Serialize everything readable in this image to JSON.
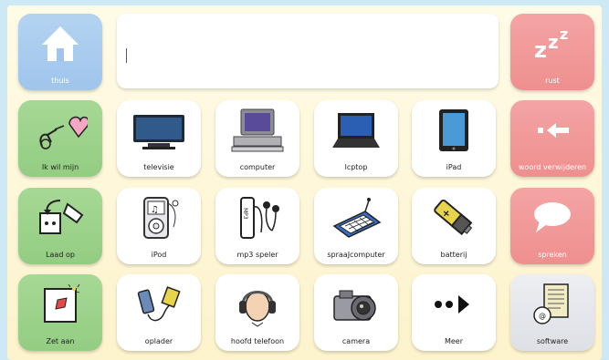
{
  "message_bar": {
    "text": ""
  },
  "tiles": {
    "thuis": "thuis",
    "rust": "rust",
    "rust_icon": "zzz",
    "ik_wil_mijn": "Ik wil mijn",
    "televisie": "televisie",
    "computer": "computer",
    "laptop": "lcptop",
    "ipad": "iPad",
    "woord_verwijderen": "woord verwijderen",
    "laad_op": "Laad op",
    "ipod": "iPod",
    "mp3_speler": "mp3 speler",
    "spraakcomputer": "spraaJcomputer",
    "batterij": "batterij",
    "spreken": "spreken",
    "zet_aan": "Zet aan",
    "oplader": "oplader",
    "hoofd_telefoon": "hoofd telefoon",
    "camera": "camera",
    "meer": "Meer",
    "software": "software"
  },
  "colors": {
    "nav_blue": "#9fc5ec",
    "action_green": "#93cd82",
    "action_red": "#ef8f8f",
    "background_cream": "#fdf3cc"
  }
}
